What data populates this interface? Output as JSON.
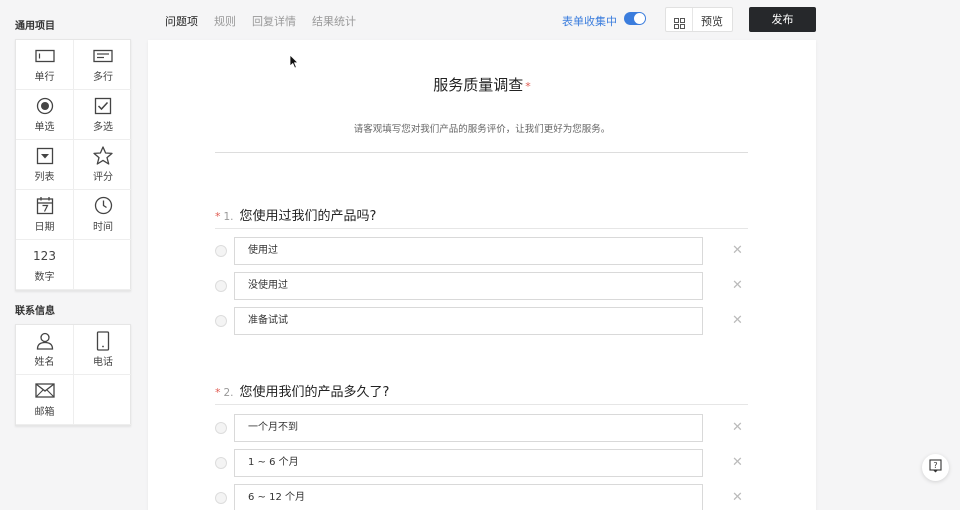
{
  "header": {
    "tabs": [
      {
        "label": "问题项",
        "active": true
      },
      {
        "label": "规则",
        "active": false
      },
      {
        "label": "回复详情",
        "active": false
      },
      {
        "label": "结果统计",
        "active": false
      }
    ],
    "collect_label": "表单收集中",
    "collect_enabled": true,
    "preview_label": "预览",
    "publish_label": "发布"
  },
  "sidebar": {
    "common_title": "通用项目",
    "common_items": [
      {
        "label": "单行",
        "icon": "single-line-icon"
      },
      {
        "label": "多行",
        "icon": "multi-line-icon"
      },
      {
        "label": "单选",
        "icon": "radio-icon"
      },
      {
        "label": "多选",
        "icon": "checkbox-icon"
      },
      {
        "label": "列表",
        "icon": "dropdown-icon"
      },
      {
        "label": "评分",
        "icon": "star-icon"
      },
      {
        "label": "日期",
        "icon": "calendar-icon"
      },
      {
        "label": "时间",
        "icon": "clock-icon"
      },
      {
        "label": "数字",
        "icon": "number-icon",
        "glyph": "123"
      }
    ],
    "contact_title": "联系信息",
    "contact_items": [
      {
        "label": "姓名",
        "icon": "person-icon"
      },
      {
        "label": "电话",
        "icon": "phone-icon"
      },
      {
        "label": "邮箱",
        "icon": "mail-icon"
      }
    ]
  },
  "form": {
    "title": "服务质量调查",
    "required_mark": "*",
    "description": "请客观填写您对我们产品的服务评价，让我们更好为您服务。",
    "questions": [
      {
        "number": "1.",
        "title": "您使用过我们的产品吗?",
        "options": [
          "使用过",
          "没使用过",
          "准备试试"
        ]
      },
      {
        "number": "2.",
        "title": "您使用我们的产品多久了?",
        "options": [
          "一个月不到",
          "1 ~ 6 个月",
          "6 ~ 12 个月"
        ]
      }
    ]
  },
  "colors": {
    "accent": "#3b7ddd",
    "publish_bg": "#26282b",
    "required": "#e05a50"
  }
}
